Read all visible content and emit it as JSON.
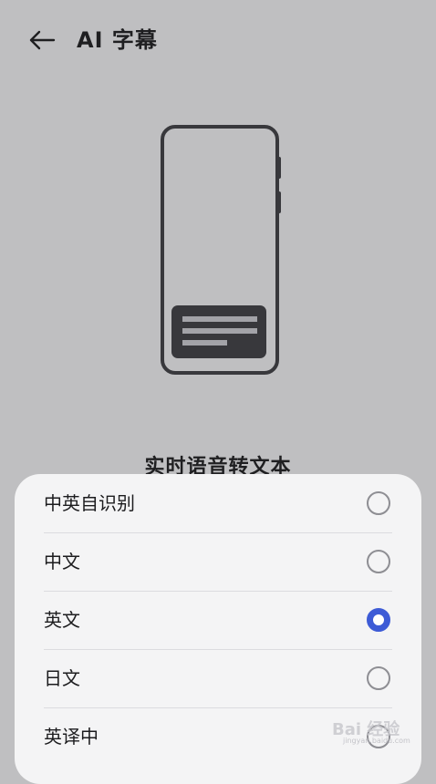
{
  "header": {
    "title": "AI 字幕",
    "back_icon": "arrow-left-icon"
  },
  "illustration": {
    "icon": "phone-with-subtitle-illustration"
  },
  "page": {
    "description_heading": "实时语音转文本"
  },
  "language_sheet": {
    "options": [
      {
        "label": "中英自识别",
        "selected": false
      },
      {
        "label": "中文",
        "selected": false
      },
      {
        "label": "英文",
        "selected": true
      },
      {
        "label": "日文",
        "selected": false
      },
      {
        "label": "英译中",
        "selected": false
      }
    ],
    "accent_color": "#3d5bd6"
  },
  "watermark": {
    "text": "Bai 经验",
    "subtext": "jingyan.baidu.com"
  }
}
